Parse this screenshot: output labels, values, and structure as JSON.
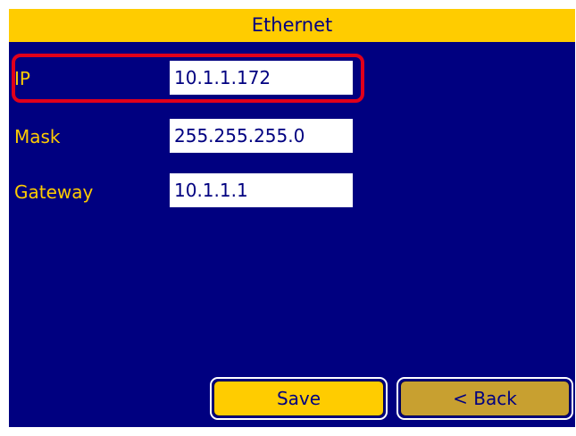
{
  "title": "Ethernet",
  "fields": [
    {
      "label": "IP",
      "value": "10.1.1.172"
    },
    {
      "label": "Mask",
      "value": "255.255.255.0"
    },
    {
      "label": "Gateway",
      "value": "10.1.1.1"
    }
  ],
  "buttons": {
    "save": "Save",
    "back": "< Back"
  },
  "colors": {
    "background": "#000080",
    "accent": "#ffcc00",
    "text_on_accent": "#000080",
    "highlight": "#e0001b",
    "back_button": "#c8a030"
  }
}
